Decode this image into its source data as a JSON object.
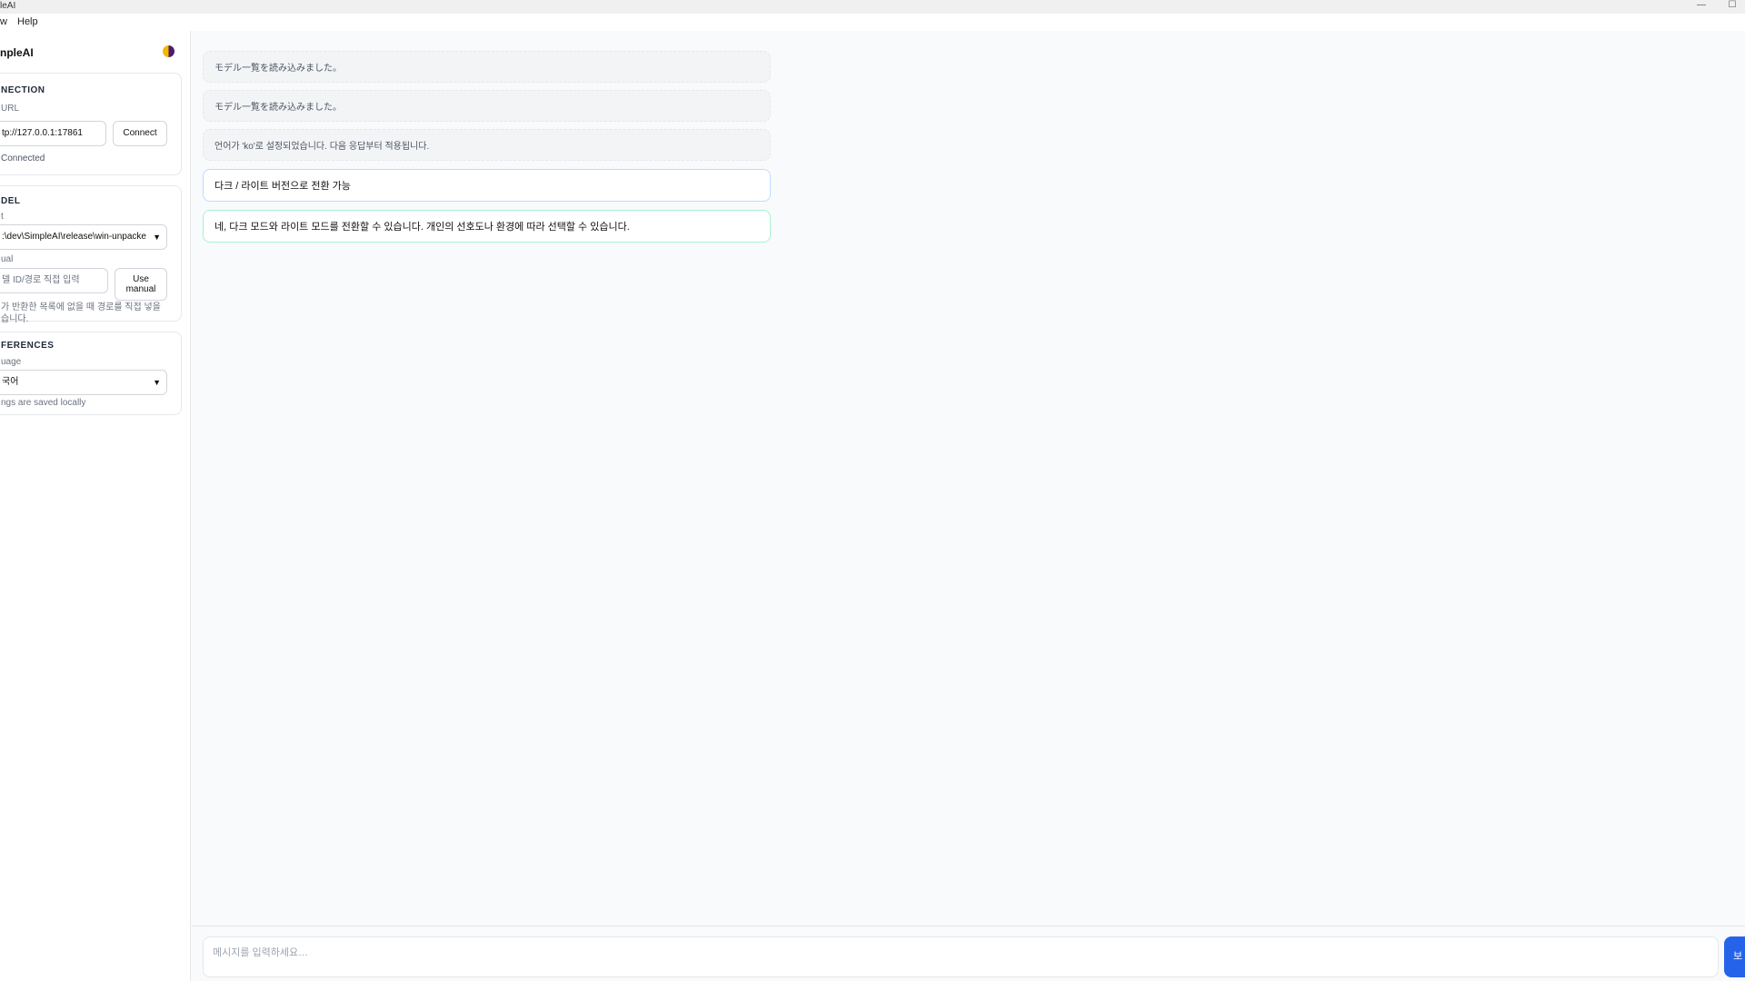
{
  "window": {
    "title": "leAI",
    "minimize_glyph": "—",
    "maximize_glyph": "☐"
  },
  "menu": {
    "items": [
      "w",
      "Help"
    ]
  },
  "sidebar": {
    "brand": "npleAI",
    "theme_icon": "half-circle-icon",
    "connection": {
      "title": "NECTION",
      "url_label": "URL",
      "url_value": "tp://127.0.0.1:17861",
      "connect_label": "Connect",
      "status": "Connected"
    },
    "model": {
      "title": "DEL",
      "select_label": "t",
      "select_value": ":\\dev\\SimpleAI\\release\\win-unpacke",
      "manual_label": "ual",
      "manual_placeholder": "델 ID/경로 직접 입력",
      "use_manual_line1": "Use",
      "use_manual_line2": "manual",
      "hint_line1": "가 반환한 목록에 없을 때 경로를 직접 넣을",
      "hint_line2": "습니다."
    },
    "preferences": {
      "title": "FERENCES",
      "language_label": "uage",
      "language_value": "국어",
      "saved_note": "ngs are saved locally"
    }
  },
  "chat": {
    "messages": [
      {
        "role": "system",
        "text": "モデル一覧を読み込みました。"
      },
      {
        "role": "system",
        "text": "モデル一覧を読み込みました。"
      },
      {
        "role": "system",
        "text": "언어가 'ko'로 설정되었습니다. 다음 응답부터 적용됩니다."
      },
      {
        "role": "user",
        "text": "다크 / 라이트 버전으로 전환 가능"
      },
      {
        "role": "assistant",
        "text": "네, 다크 모드와 라이트 모드를 전환할 수 있습니다. 개인의 선호도나 환경에 따라 선택할 수 있습니다."
      }
    ]
  },
  "composer": {
    "placeholder": "메시지를 입력하세요…",
    "send_label": "보"
  },
  "colors": {
    "accent": "#2563eb",
    "user_border": "#bfdbfe",
    "assistant_border": "#a7f3d0"
  }
}
